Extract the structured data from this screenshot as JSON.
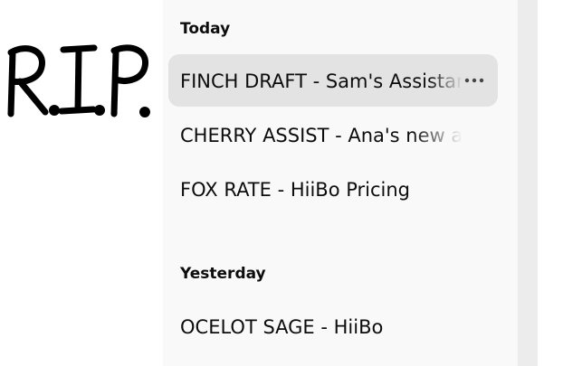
{
  "overlay": {
    "handwritten_text": "R.I.P."
  },
  "sidebar": {
    "sections": [
      {
        "heading": "Today",
        "items": [
          {
            "title": "FINCH DRAFT - Sam's Assistant",
            "active": true,
            "more_icon": "more-horizontal-icon"
          },
          {
            "title": "CHERRY ASSIST - Ana's new assistant",
            "active": false
          },
          {
            "title": "FOX RATE - HiiBo Pricing",
            "active": false
          }
        ]
      },
      {
        "heading": "Yesterday",
        "items": [
          {
            "title": "OCELOT SAGE - HiiBo",
            "active": false
          }
        ]
      }
    ]
  },
  "colors": {
    "sidebar_bg": "#f9f9f9",
    "active_item_bg": "#e3e3e3",
    "scroll_track": "#ececec",
    "text": "#0d0d0d",
    "handwriting": "#000000"
  }
}
